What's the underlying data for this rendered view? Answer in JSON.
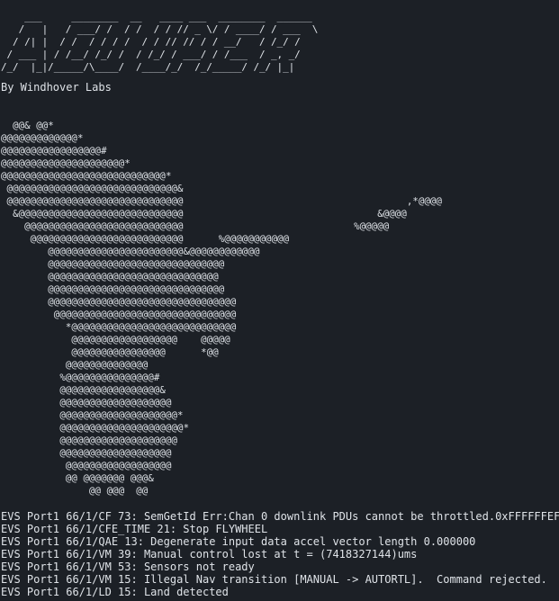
{
  "terminal": {
    "banner": "    ___     ________  __   ____ ___  ________  ______\n   /   |   / ___/ /  / /  / / // _ \\/ / ____/ / ___  \\\n  / /| |  / /  / / / /  / / // // / / __/   / /_/ /\n / ___ | / /__/ /_/ /  / /_/ / ___/ / /___  / _, _/\n/_/  |_|/_____/\\____/  /____/_/  /_/_____/ /_/ |_|",
    "byline": "By Windhover Labs",
    "art": "  @@& @@*\n@@@@@@@@@@@@@*\n@@@@@@@@@@@@@@@@@#\n@@@@@@@@@@@@@@@@@@@@@*\n@@@@@@@@@@@@@@@@@@@@@@@@@@@@*\n @@@@@@@@@@@@@@@@@@@@@@@@@@@@@&\n @@@@@@@@@@@@@@@@@@@@@@@@@@@@@@                                      ,*@@@@\n  &@@@@@@@@@@@@@@@@@@@@@@@@@@@@                                 &@@@@\n    @@@@@@@@@@@@@@@@@@@@@@@@@@@                             %@@@@@\n     @@@@@@@@@@@@@@@@@@@@@@@@@@      %@@@@@@@@@@@\n        @@@@@@@@@@@@@@@@@@@@@@@&@@@@@@@@@@@@\n        @@@@@@@@@@@@@@@@@@@@@@@@@@@@@@\n        @@@@@@@@@@@@@@@@@@@@@@@@@@@@@\n        @@@@@@@@@@@@@@@@@@@@@@@@@@@@@@\n        @@@@@@@@@@@@@@@@@@@@@@@@@@@@@@@@\n         @@@@@@@@@@@@@@@@@@@@@@@@@@@@@@@\n           *@@@@@@@@@@@@@@@@@@@@@@@@@@@@\n            @@@@@@@@@@@@@@@@@@    @@@@@\n            @@@@@@@@@@@@@@@@      *@@\n           @@@@@@@@@@@@@@\n          %@@@@@@@@@@@@@@@#\n          @@@@@@@@@@@@@@@@@&\n          @@@@@@@@@@@@@@@@@@@\n          @@@@@@@@@@@@@@@@@@@@*\n          @@@@@@@@@@@@@@@@@@@@@*\n          @@@@@@@@@@@@@@@@@@@@\n          @@@@@@@@@@@@@@@@@@@\n           @@@@@@@@@@@@@@@@@@\n           @@ @@@@@@@ @@@&\n               @@ @@@  @@",
    "log_lines": [
      "EVS Port1 66/1/CF 73: SemGetId Err:Chan 0 downlink PDUs cannot be throttled.0xFFFFFFEF",
      "EVS Port1 66/1/CFE_TIME 21: Stop FLYWHEEL",
      "EVS Port1 66/1/QAE 13: Degenerate input data accel vector length 0.000000",
      "EVS Port1 66/1/VM 39: Manual control lost at t = (7418327144)ums",
      "EVS Port1 66/1/VM 53: Sensors not ready",
      "EVS Port1 66/1/VM 15: Illegal Nav transition [MANUAL -> AUTORTL].  Command rejected.",
      "EVS Port1 66/1/LD 15: Land detected"
    ]
  },
  "colors": {
    "background": "#1c2026",
    "text": "#dfe3e8"
  }
}
